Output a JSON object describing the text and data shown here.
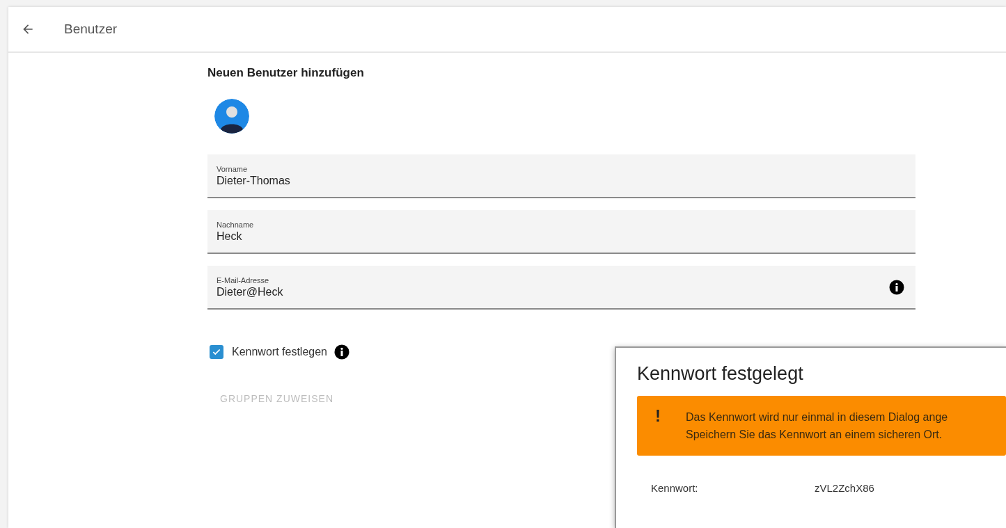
{
  "app_bar": {
    "title": "Benutzer"
  },
  "form": {
    "heading": "Neuen Benutzer hinzufügen",
    "fields": [
      {
        "label": "Vorname",
        "value": "Dieter-Thomas",
        "info": false
      },
      {
        "label": "Nachname",
        "value": "Heck",
        "info": false
      },
      {
        "label": "E-Mail-Adresse",
        "value": "Dieter@Heck",
        "info": true
      }
    ],
    "checkbox": {
      "label": "Kennwort festlegen",
      "checked": true,
      "info": true
    },
    "button": {
      "label": "GRUPPEN ZUWEISEN",
      "disabled": true
    }
  },
  "dialog": {
    "title": "Kennwort festgelegt",
    "alert": {
      "icon": "!",
      "lines": [
        "Das Kennwort wird nur einmal in diesem Dialog ange",
        "Speichern Sie das Kennwort an einem sicheren Ort."
      ]
    },
    "rows": [
      {
        "label": "Kennwort:",
        "value": "zVL2ZchX86"
      }
    ]
  }
}
